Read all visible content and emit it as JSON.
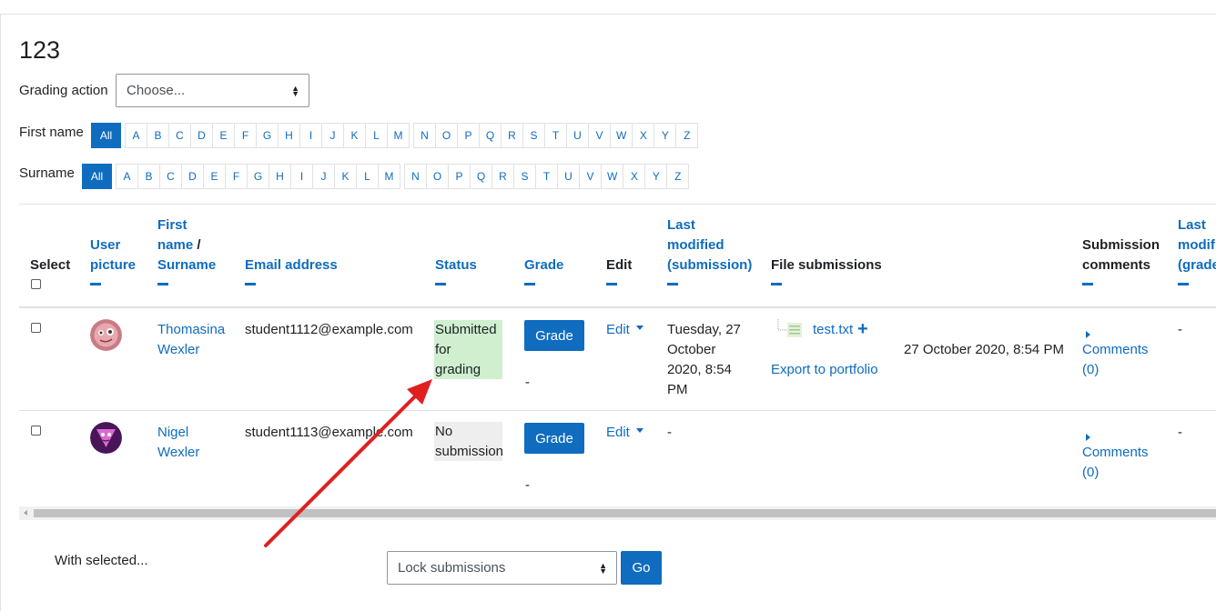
{
  "page": {
    "title": "123"
  },
  "grading_action": {
    "label": "Grading action",
    "value": "Choose..."
  },
  "filters": {
    "first_name_label": "First name",
    "surname_label": "Surname",
    "all_label": "All",
    "letters": [
      "A",
      "B",
      "C",
      "D",
      "E",
      "F",
      "G",
      "H",
      "I",
      "J",
      "K",
      "L",
      "M",
      "N",
      "O",
      "P",
      "Q",
      "R",
      "S",
      "T",
      "U",
      "V",
      "W",
      "X",
      "Y",
      "Z"
    ]
  },
  "table": {
    "headers": {
      "select": "Select",
      "user_picture_1": "User",
      "user_picture_2": "picture",
      "first_name_1": "First",
      "first_name_2": "name",
      "slash": " /",
      "surname": "Surname",
      "email": "Email address",
      "status": "Status",
      "grade": "Grade",
      "edit": "Edit",
      "last_modified_1": "Last",
      "last_modified_2": "modified",
      "last_modified_3": "(submission)",
      "file_submissions": "File submissions",
      "submission_comments_1": "Submission",
      "submission_comments_2": "comments",
      "last_modified_grade_1": "Last",
      "last_modified_grade_2": "modif",
      "last_modified_grade_3": "(grade"
    },
    "rows": [
      {
        "first": "Thomasina",
        "last": "Wexler",
        "email": "student1112@example.com",
        "status_1": "Submitted",
        "status_2": "for",
        "status_3": "grading",
        "grade_button": "Grade",
        "grade_value": "-",
        "edit": "Edit",
        "modified_1": "Tuesday, 27",
        "modified_2": "October",
        "modified_3": "2020, 8:54",
        "modified_4": "PM",
        "file_name": "test.txt",
        "file_plus": "+",
        "file_time": "27 October 2020, 8:54 PM",
        "export": "Export to portfolio",
        "comments": "Comments",
        "comments_count": "(0)",
        "last_grade": "-"
      },
      {
        "first": "Nigel",
        "last": "Wexler",
        "email": "student1113@example.com",
        "status_1": "No",
        "status_2": "submission",
        "grade_button": "Grade",
        "grade_value": "-",
        "edit": "Edit",
        "modified": "-",
        "comments": "Comments",
        "comments_count": "(0)",
        "last_grade": "-"
      }
    ]
  },
  "bulk": {
    "label": "With selected...",
    "select_value": "Lock submissions",
    "go_label": "Go"
  },
  "colors": {
    "accent": "#0f6cbf",
    "submitted_bg": "#cfefcf",
    "arrow": "#e02020"
  }
}
